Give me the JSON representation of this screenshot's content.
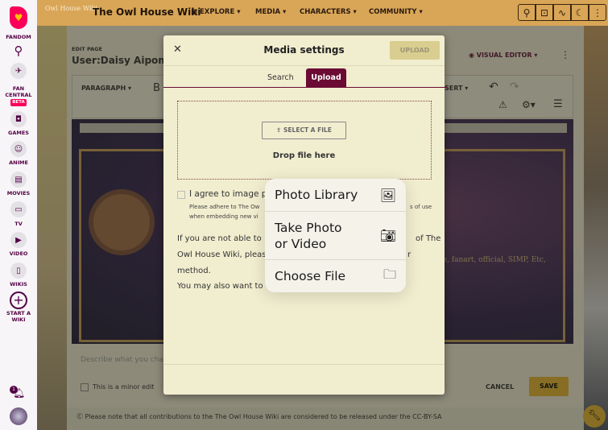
{
  "rail": {
    "brand": "FANDOM",
    "items": [
      {
        "label": "FAN CENTRAL",
        "badge": "BETA"
      },
      {
        "label": "GAMES"
      },
      {
        "label": "ANIME"
      },
      {
        "label": "MOVIES"
      },
      {
        "label": "TV"
      },
      {
        "label": "VIDEO"
      },
      {
        "label": "WIKIS"
      },
      {
        "label": "START A WIKI"
      }
    ],
    "notifications": "1"
  },
  "topbar": {
    "logo": "Owl House Wiki",
    "title": "The Owl House Wiki",
    "nav": [
      "EXPLORE",
      "MEDIA",
      "CHARACTERS",
      "COMMUNITY"
    ]
  },
  "page": {
    "eyebrow": "EDIT PAGE",
    "title": "User:Daisy Aipom",
    "visual_editor": "VISUAL EDITOR",
    "paragraph": "PARAGRAPH",
    "bold": "B",
    "insert": "SERT",
    "art_text": "ore, fanart, official, SIMP, Etc,",
    "summary_placeholder": "Describe what you cha",
    "minor_edit": "This is a minor edit",
    "cancel": "CANCEL",
    "save": "SAVE",
    "license": "Please note that all contributions to the The Owl House Wiki are considered to be released under the CC-BY-SA"
  },
  "modal": {
    "title": "Media settings",
    "upload_button": "UPLOAD",
    "tabs": [
      "Search",
      "Upload"
    ],
    "select_file": "SELECT A FILE",
    "drop": "Drop file here",
    "agree": "I agree to image po",
    "agree_note_1": "Please adhere to The Ow",
    "agree_note_1b": "s of use",
    "agree_note_2": "when embedding new vi",
    "para": [
      "If you are not able to",
      "of The",
      "Owl House Wiki, pleas",
      "r",
      "method.",
      "You may also want to"
    ]
  },
  "popup": {
    "items": [
      {
        "label": "Photo Library",
        "icon": "photo-library-icon"
      },
      {
        "label": "Take Photo or Video",
        "icon": "camera-icon"
      },
      {
        "label": "Choose File",
        "icon": "folder-icon"
      }
    ]
  }
}
